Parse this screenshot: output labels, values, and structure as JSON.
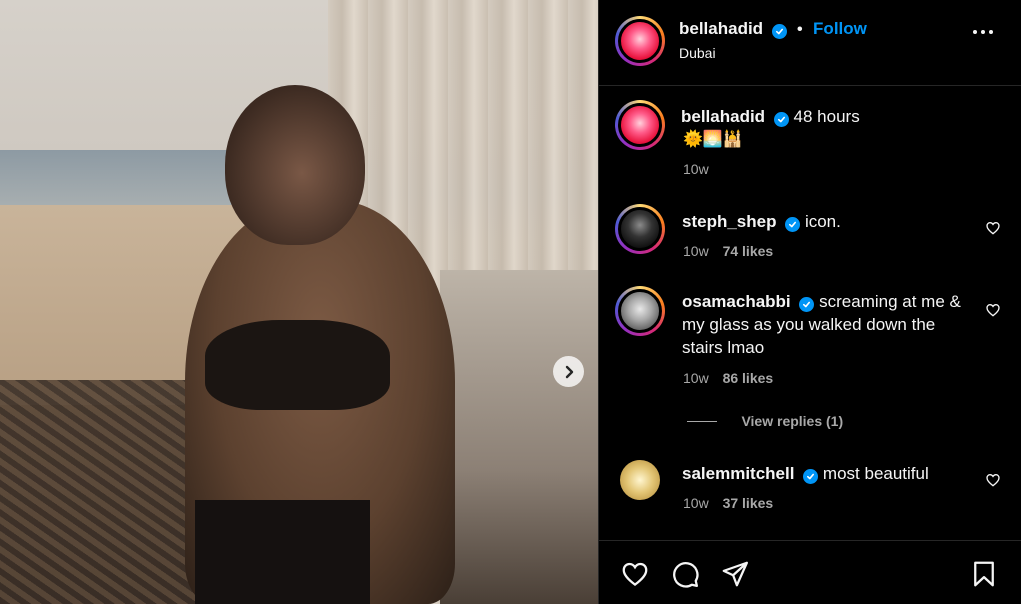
{
  "post": {
    "author": "bellahadid",
    "location": "Dubai",
    "follow_label": "Follow",
    "caption_author": "bellahadid",
    "caption": "48 hours",
    "caption_emojis": "🌞🌅🕌",
    "caption_time": "10w"
  },
  "comments": [
    {
      "user": "steph_shep",
      "text": "icon.",
      "time": "10w",
      "likes": "74 likes"
    },
    {
      "user": "osamachabbi",
      "text_line1": "screaming at me &",
      "text_line2": "my glass as you walked down the",
      "text_line3": "stairs lmao",
      "time": "10w",
      "likes": "86 likes",
      "replies": "View replies (1)"
    },
    {
      "user": "salemmitchell",
      "text": "most beautiful",
      "time": "10w",
      "likes": "37 likes"
    }
  ],
  "icons": {
    "like": "heart-icon",
    "comment": "comment-icon",
    "share": "send-icon",
    "save": "bookmark-icon",
    "more": "more-options-icon",
    "next": "chevron-right-icon",
    "verified": "verified-badge-icon"
  },
  "colors": {
    "accent": "#0095f6",
    "background": "#000000",
    "muted": "#a8a8a8",
    "divider": "#262626"
  }
}
